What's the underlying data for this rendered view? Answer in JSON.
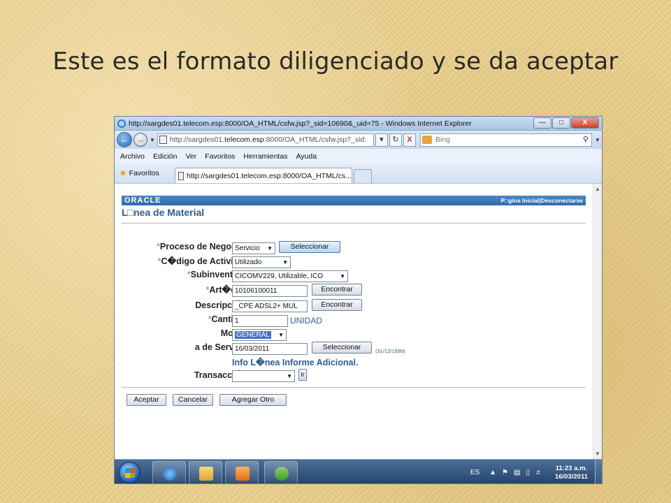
{
  "slide_title": "Este es el formato diligenciado y se da aceptar",
  "browser": {
    "window_title": "http://sargdes01.telecom.esp:8000/OA_HTML/csfw.jsp?_sid=10690&_uid=75 - Windows Internet Explorer",
    "address_prefix": "http://sargdes01.",
    "address_domain": "telecom.esp",
    "address_suffix": ":8000/OA_HTML/csfw.jsp?_sid:",
    "search_placeholder": "Bing",
    "menu": [
      "Archivo",
      "Edición",
      "Ver",
      "Favoritos",
      "Herramientas",
      "Ayuda"
    ],
    "favorites_label": "Favoritos",
    "tab_label": "http://sargdes01.telecom.esp:8000/OA_HTML/cs...",
    "minimize": "—",
    "restore": "□",
    "close": "X",
    "stop_label": "X"
  },
  "page": {
    "logo": "ORACLE",
    "header_links": "P□gina Inicial|Desconectarse",
    "title": "L□nea de Material",
    "fields": {
      "proceso": {
        "label": "Proceso de Negocios",
        "value": "Servicio",
        "button": "Seleccionar"
      },
      "codigo": {
        "label": "C�digo de Actividad",
        "value": "Utilizado"
      },
      "subinventario": {
        "label": "Subinventario",
        "value": "CICOMV229, Utilizable, ICO"
      },
      "articulo": {
        "label": "Art�culo",
        "value": "10106100011",
        "button": "Encontrar"
      },
      "descripcion": {
        "label": "Descripci�n",
        "value": "_CPE ADSL2+ MUL",
        "button": "Encontrar"
      },
      "cantidad": {
        "label": "Cantidad",
        "value": "1",
        "unit": "UNIDAD"
      },
      "motivo": {
        "label": "Motivo",
        "value": "GENERAL"
      },
      "fecha": {
        "label": "a de Servicio",
        "value": "16/03/2011",
        "button": "Seleccionar",
        "hint": "(31/12/1999)"
      },
      "info_link": "Info L�nea Informe Adicional.",
      "transaccion": {
        "label": "Transacci�n",
        "value": "",
        "button": "Ir"
      }
    },
    "required_mark": "*",
    "actions": {
      "accept": "Aceptar",
      "cancel": "Cancelar",
      "add_other": "Agregar Otro"
    }
  },
  "taskbar": {
    "language": "ES",
    "time": "11:23 a.m.",
    "date": "16/03/2011",
    "items": [
      "ie-icon",
      "explorer-icon",
      "media-player-icon",
      "messenger-icon"
    ]
  },
  "colors": {
    "oracle_band": "#2d6ab0",
    "page_title": "#2f5d8a",
    "required": "#4f82b8",
    "slide_bg": "#e9cf8e"
  }
}
